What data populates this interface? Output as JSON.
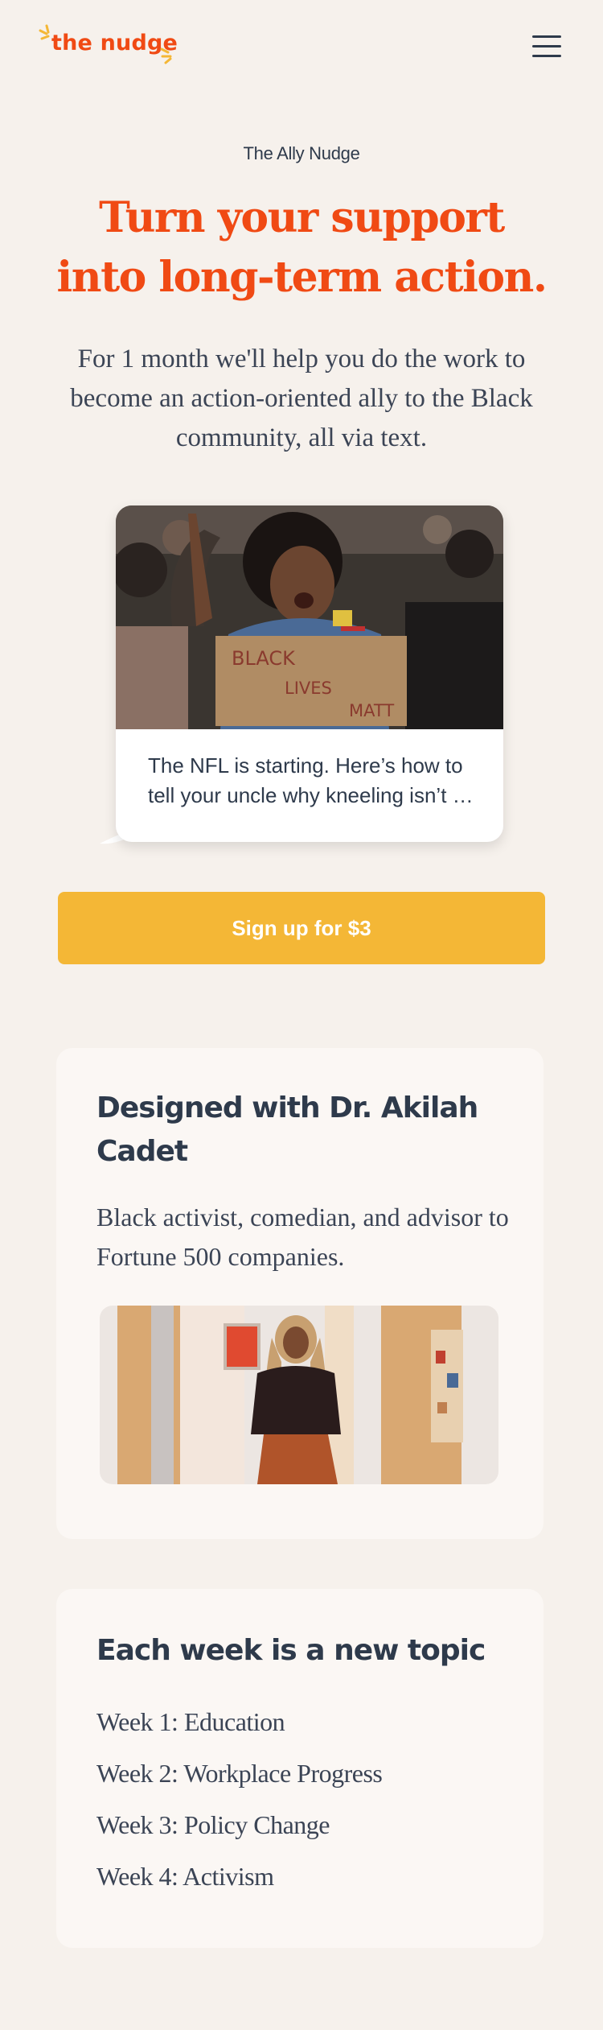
{
  "header": {
    "logo_text": "the nudge",
    "brand_color": "#f04a14",
    "logo_spark_color": "#f4b736",
    "menu_icon": "hamburger-menu-icon"
  },
  "hero": {
    "eyebrow": "The Ally Nudge",
    "title": "Turn your support into long-term action.",
    "subtitle": "For 1 month we'll help you do the work to become an action-oriented ally to the Black community, all via text."
  },
  "message_preview": {
    "sign_text": "BLACK LIVES MATTER",
    "text": "The NFL is starting. Here’s how to tell your uncle why kneeling isn’t …"
  },
  "cta": {
    "label": "Sign up for $3",
    "color": "#f4b736"
  },
  "expert_card": {
    "title": "Designed with Dr. Akilah Cadet",
    "description": "Black activist, comedian, and advisor to Fortune 500 companies."
  },
  "weeks_card": {
    "title": "Each week is a new topic",
    "weeks": [
      "Week 1: Education",
      "Week 2: Workplace Progress",
      "Week 3: Policy Change",
      "Week 4: Activism"
    ]
  }
}
